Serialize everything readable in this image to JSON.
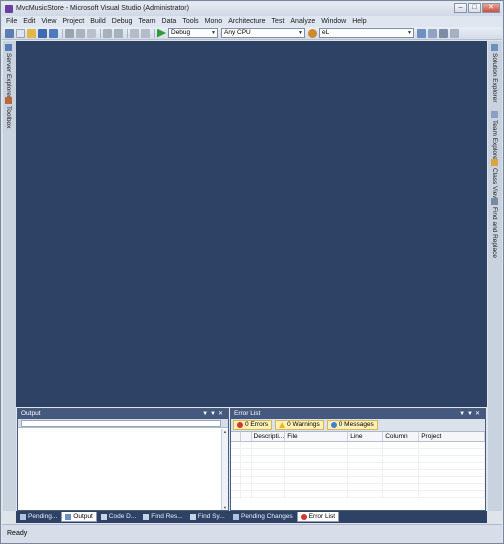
{
  "window": {
    "title": "MvcMusicStore - Microsoft Visual Studio (Administrator)",
    "controls": [
      "minimize-icon",
      "maximize-icon",
      "close-icon"
    ]
  },
  "menu": [
    "File",
    "Edit",
    "View",
    "Project",
    "Build",
    "Debug",
    "Team",
    "Data",
    "Tools",
    "Mono",
    "Architecture",
    "Test",
    "Analyze",
    "Window",
    "Help"
  ],
  "toolbar": {
    "configuration": "Debug",
    "platform": "Any CPU",
    "find": "eL"
  },
  "left_tabs": [
    "Server Explorer",
    "Toolbox"
  ],
  "right_tabs": [
    "Solution Explorer",
    "Team Explorer",
    "Class View",
    "Find and Replace"
  ],
  "output": {
    "title": "Output"
  },
  "error_list": {
    "title": "Error List",
    "errors": "0 Errors",
    "warnings": "0 Warnings",
    "messages": "0 Messages",
    "columns": [
      "",
      "",
      "Descripti...",
      "File",
      "Line",
      "Column",
      "Project"
    ]
  },
  "bottom_tabs_left": [
    "Pending...",
    "Output",
    "Code D...",
    "Find Res...",
    "Find Sy..."
  ],
  "bottom_tabs_right": [
    "Pending Changes",
    "Error List"
  ],
  "status": "Ready",
  "colors": {
    "editor_background": "#2e4266",
    "pane_header": "#45597e",
    "error_icon": "#d8352a",
    "warning_icon": "#e8b620",
    "message_icon": "#3f7fd8"
  }
}
